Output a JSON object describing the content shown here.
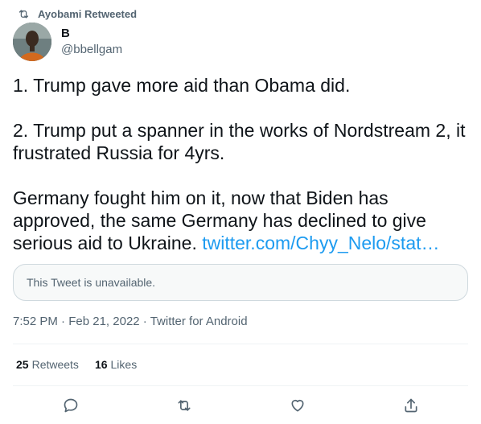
{
  "retweet_context": {
    "text": "Ayobami Retweeted",
    "icon": "retweet-icon"
  },
  "author": {
    "display_name": "B",
    "handle": "@bbellgam",
    "avatar": "avatar"
  },
  "tweet": {
    "text_1": "1. Trump gave more aid than Obama did.\n\n2. Trump put a spanner in the works of Nordstream 2, it frustrated Russia for 4yrs.\n\nGermany fought him on it, now that Biden has approved, the same Germany has declined to give serious aid to Ukraine. ",
    "link": "twitter.com/Chyy_Nelo/stat…"
  },
  "quote": {
    "text": "This Tweet is unavailable."
  },
  "meta": {
    "time": "7:52 PM",
    "sep1": " · ",
    "date": "Feb 21, 2022",
    "sep2": " · ",
    "app": "Twitter for Android"
  },
  "stats": {
    "retweets_count": "25",
    "retweets_label": "Retweets",
    "likes_count": "16",
    "likes_label": "Likes"
  },
  "actions": [
    "reply-icon",
    "retweet-icon",
    "like-icon",
    "share-icon"
  ],
  "colors": {
    "link": "#1d9bf0",
    "secondary": "#536471",
    "primary": "#0f1419",
    "border": "#cfd9de"
  }
}
